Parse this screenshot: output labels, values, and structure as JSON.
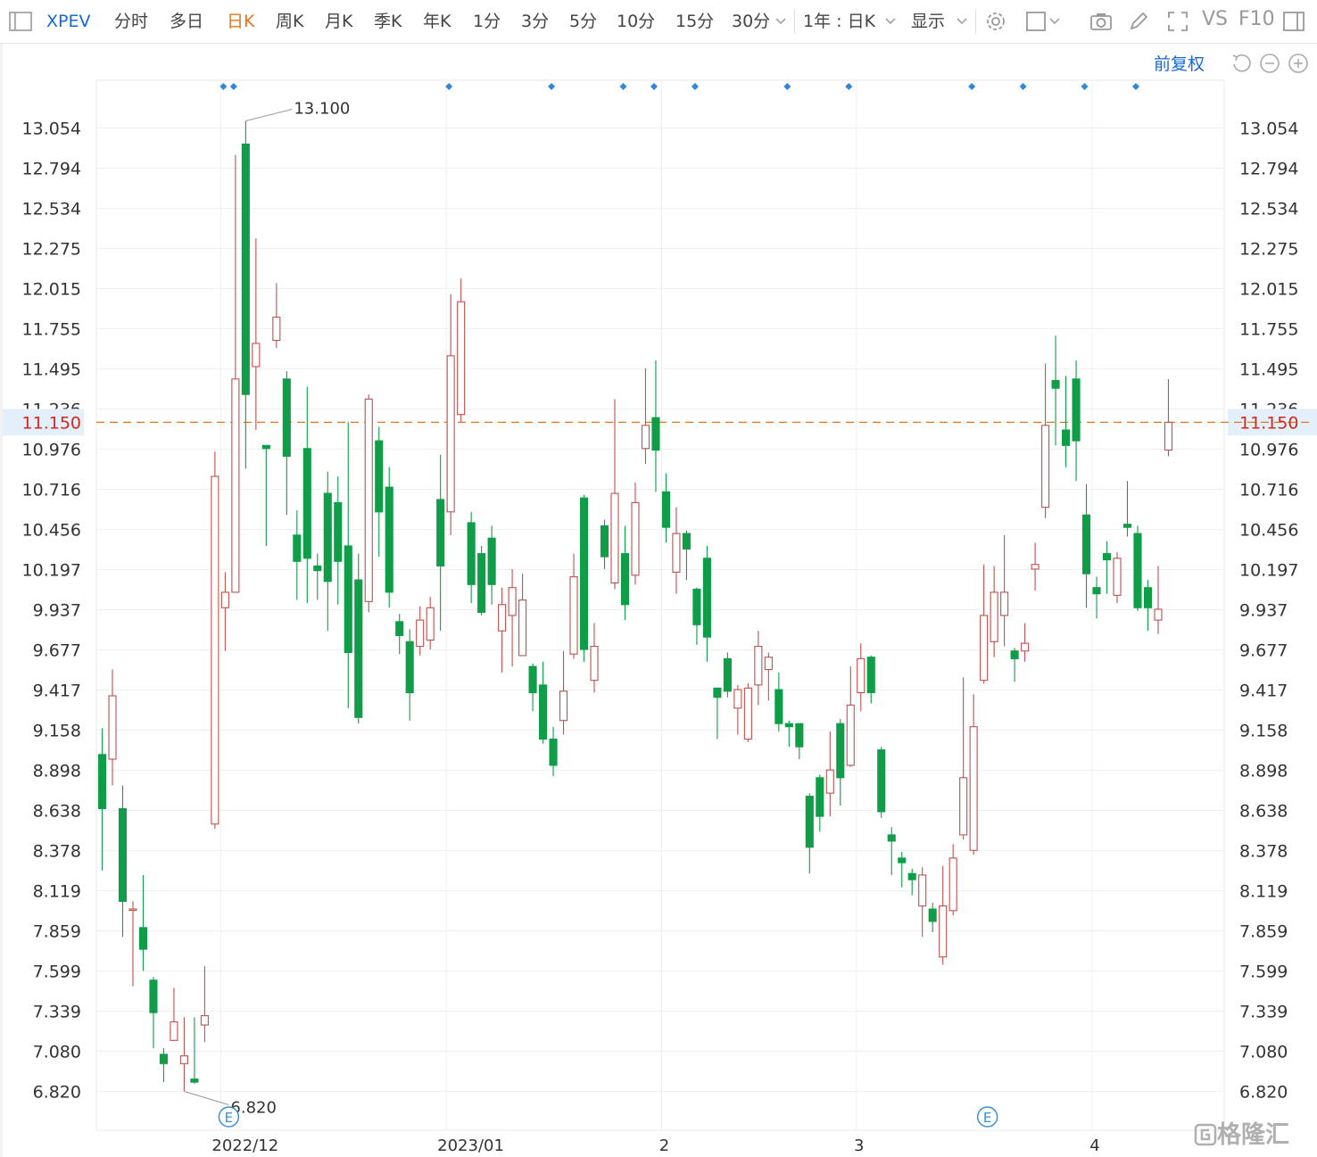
{
  "toolbar": {
    "symbol": "XPEV",
    "periods": [
      "分时",
      "多日",
      "日K",
      "周K",
      "月K",
      "季K",
      "年K",
      "1分",
      "3分",
      "5分",
      "10分",
      "15分",
      "30分"
    ],
    "active_period": "日K",
    "range_label": "1年 : 日K",
    "display_label": "显示",
    "vs_label": "VS",
    "f10_label": "F10",
    "icons": [
      "settings-icon",
      "square-icon",
      "camera-icon",
      "pencil-icon",
      "fullscreen-icon"
    ]
  },
  "adjust_label": "前复权",
  "watermark": "格隆汇",
  "colors": {
    "up": "#c0504d",
    "down": "#0f9d48",
    "current": "#e8741c",
    "accent": "#1768d6"
  },
  "chart_data": {
    "type": "candlestick",
    "current_price": 11.15,
    "current_price_label": "11.150",
    "y_ticks": [
      "6.820",
      "7.080",
      "7.339",
      "7.599",
      "7.859",
      "8.119",
      "8.378",
      "8.638",
      "8.898",
      "9.158",
      "9.417",
      "9.677",
      "9.937",
      "10.197",
      "10.456",
      "10.716",
      "10.976",
      "11.236",
      "11.495",
      "11.755",
      "12.015",
      "12.275",
      "12.534",
      "12.794",
      "13.054"
    ],
    "ylim": [
      6.59,
      13.35
    ],
    "x_labels": [
      {
        "label": "2022/12",
        "index": 12
      },
      {
        "label": "2023/01",
        "index": 34
      },
      {
        "label": "2",
        "index": 55
      },
      {
        "label": "3",
        "index": 74
      },
      {
        "label": "4",
        "index": 97
      }
    ],
    "max_marker": {
      "label": "13.100",
      "value": 13.1,
      "index": 14
    },
    "min_marker": {
      "label": "6.820",
      "value": 6.82,
      "index": 8
    },
    "event_markers": [
      {
        "label": "E",
        "index": 12
      },
      {
        "label": "E",
        "index": 86
      }
    ],
    "top_markers": [
      12,
      13,
      34,
      44,
      51,
      54,
      58,
      67,
      73,
      85,
      90,
      96,
      101
    ],
    "candles": [
      [
        9.0,
        8.65,
        9.17,
        8.25
      ],
      [
        8.97,
        9.38,
        9.55,
        8.8
      ],
      [
        8.65,
        8.05,
        8.8,
        7.82
      ],
      [
        8.0,
        8.0,
        8.05,
        7.5
      ],
      [
        7.88,
        7.74,
        8.22,
        7.6
      ],
      [
        7.54,
        7.33,
        7.56,
        7.1
      ],
      [
        7.06,
        7.0,
        7.1,
        6.88
      ],
      [
        7.15,
        7.27,
        7.49,
        7.15
      ],
      [
        7.0,
        7.05,
        7.3,
        6.82
      ],
      [
        6.9,
        6.88,
        7.3,
        6.87
      ],
      [
        7.25,
        7.31,
        7.63,
        7.14
      ],
      [
        8.55,
        10.8,
        10.96,
        8.52
      ],
      [
        9.95,
        10.05,
        10.18,
        9.67
      ],
      [
        10.05,
        11.43,
        12.88,
        10.05
      ],
      [
        12.95,
        11.33,
        13.1,
        10.85
      ],
      [
        11.51,
        11.66,
        12.34,
        11.1
      ],
      [
        11.0,
        10.98,
        10.98,
        10.35
      ],
      [
        11.68,
        11.83,
        12.05,
        11.63
      ],
      [
        11.43,
        10.93,
        11.48,
        10.55
      ],
      [
        10.42,
        10.25,
        10.58,
        10.0
      ],
      [
        10.98,
        10.27,
        11.38,
        9.98
      ],
      [
        10.22,
        10.19,
        10.3,
        10.0
      ],
      [
        10.69,
        10.12,
        10.83,
        9.8
      ],
      [
        10.63,
        10.25,
        10.8,
        9.97
      ],
      [
        10.35,
        9.66,
        11.15,
        9.3
      ],
      [
        10.13,
        9.24,
        10.3,
        9.2
      ],
      [
        9.99,
        11.3,
        11.33,
        9.92
      ],
      [
        11.03,
        10.57,
        11.12,
        10.28
      ],
      [
        10.73,
        10.05,
        10.86,
        9.95
      ],
      [
        9.86,
        9.77,
        9.91,
        9.65
      ],
      [
        9.73,
        9.4,
        9.81,
        9.22
      ],
      [
        9.7,
        9.87,
        9.96,
        9.64
      ],
      [
        9.74,
        9.95,
        10.02,
        9.68
      ],
      [
        10.65,
        10.22,
        10.94,
        9.8
      ],
      [
        10.57,
        11.58,
        11.98,
        10.42
      ],
      [
        11.2,
        11.93,
        12.08,
        11.15
      ],
      [
        10.5,
        10.1,
        10.57,
        9.98
      ],
      [
        10.3,
        9.92,
        10.35,
        9.9
      ],
      [
        10.4,
        10.1,
        10.48,
        9.97
      ],
      [
        9.8,
        9.97,
        10.08,
        9.53
      ],
      [
        9.9,
        10.08,
        10.2,
        9.57
      ],
      [
        9.64,
        10.0,
        10.17,
        9.67
      ],
      [
        9.57,
        9.4,
        9.59,
        9.28
      ],
      [
        9.45,
        9.1,
        9.6,
        9.07
      ],
      [
        9.1,
        8.93,
        9.18,
        8.86
      ],
      [
        9.22,
        9.41,
        9.67,
        9.13
      ],
      [
        9.65,
        10.15,
        10.3,
        9.62
      ],
      [
        10.66,
        9.68,
        10.68,
        9.6
      ],
      [
        9.48,
        9.7,
        9.85,
        9.4
      ],
      [
        10.48,
        10.28,
        10.52,
        10.2
      ],
      [
        10.11,
        10.69,
        11.3,
        10.07
      ],
      [
        10.3,
        9.97,
        10.48,
        9.87
      ],
      [
        10.16,
        10.63,
        10.76,
        10.1
      ],
      [
        10.98,
        11.13,
        11.5,
        10.88
      ],
      [
        11.18,
        10.97,
        11.55,
        10.7
      ],
      [
        10.7,
        10.47,
        10.82,
        10.37
      ],
      [
        10.18,
        10.43,
        10.6,
        10.04
      ],
      [
        10.43,
        10.33,
        10.45,
        10.13
      ],
      [
        10.07,
        9.84,
        10.08,
        9.71
      ],
      [
        10.27,
        9.76,
        10.35,
        9.6
      ],
      [
        9.43,
        9.37,
        9.43,
        9.1
      ],
      [
        9.62,
        9.41,
        9.66,
        9.37
      ],
      [
        9.3,
        9.42,
        9.45,
        9.13
      ],
      [
        9.1,
        9.43,
        9.46,
        9.08
      ],
      [
        9.45,
        9.7,
        9.8,
        9.32
      ],
      [
        9.55,
        9.63,
        9.66,
        9.35
      ],
      [
        9.42,
        9.2,
        9.53,
        9.15
      ],
      [
        9.2,
        9.18,
        9.22,
        9.05
      ],
      [
        9.2,
        9.05,
        9.2,
        8.97
      ],
      [
        8.73,
        8.4,
        8.75,
        8.23
      ],
      [
        8.85,
        8.6,
        8.87,
        8.5
      ],
      [
        8.75,
        8.9,
        9.15,
        8.6
      ],
      [
        9.2,
        8.85,
        9.23,
        8.67
      ],
      [
        8.93,
        9.32,
        9.57,
        8.92
      ],
      [
        9.4,
        9.62,
        9.72,
        9.28
      ],
      [
        9.63,
        9.4,
        9.64,
        9.33
      ],
      [
        9.03,
        8.63,
        9.05,
        8.59
      ],
      [
        8.48,
        8.44,
        8.53,
        8.22
      ],
      [
        8.33,
        8.3,
        8.37,
        8.14
      ],
      [
        8.23,
        8.19,
        8.26,
        8.09
      ],
      [
        8.02,
        8.22,
        8.27,
        7.82
      ],
      [
        8.0,
        7.92,
        8.04,
        7.85
      ],
      [
        7.69,
        8.02,
        8.28,
        7.64
      ],
      [
        7.99,
        8.33,
        8.42,
        7.96
      ],
      [
        8.48,
        8.85,
        9.5,
        8.45
      ],
      [
        8.38,
        9.18,
        9.39,
        8.35
      ],
      [
        9.48,
        9.9,
        10.23,
        9.46
      ],
      [
        9.73,
        10.05,
        10.22,
        9.63
      ],
      [
        9.9,
        10.05,
        10.42,
        9.7
      ],
      [
        9.67,
        9.62,
        9.69,
        9.47
      ],
      [
        9.67,
        9.72,
        9.85,
        9.6
      ],
      [
        10.2,
        10.23,
        10.37,
        10.06
      ],
      [
        10.6,
        11.13,
        11.53,
        10.53
      ],
      [
        11.42,
        11.37,
        11.71,
        11.0
      ],
      [
        11.1,
        11.0,
        11.45,
        10.86
      ],
      [
        11.43,
        11.03,
        11.55,
        10.77
      ],
      [
        10.55,
        10.17,
        10.75,
        9.95
      ],
      [
        10.08,
        10.04,
        10.15,
        9.88
      ],
      [
        10.3,
        10.26,
        10.38,
        10.04
      ],
      [
        10.03,
        10.27,
        10.31,
        9.98
      ],
      [
        10.49,
        10.47,
        10.77,
        10.41
      ],
      [
        10.43,
        9.95,
        10.48,
        9.93
      ],
      [
        10.08,
        9.95,
        10.13,
        9.8
      ],
      [
        9.87,
        9.94,
        10.22,
        9.78
      ],
      [
        10.97,
        11.15,
        11.43,
        10.93
      ]
    ]
  }
}
